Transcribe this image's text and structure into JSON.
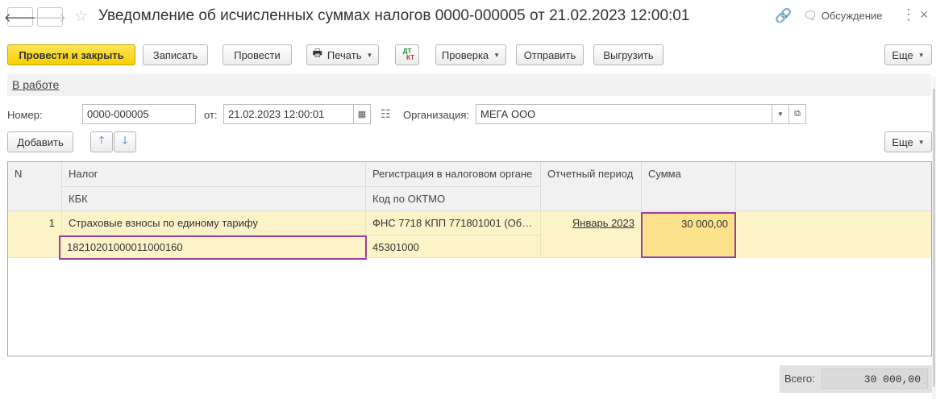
{
  "window": {
    "title": "Уведомление об исчисленных суммах налогов 0000-000005 от 21.02.2023 12:00:01",
    "discuss_label": "Обсуждение",
    "back_icon": "🡐",
    "forward_icon": "🡒",
    "star_icon": "☆",
    "link_icon": "🔗",
    "more_icon": "⋮",
    "close_icon": "×"
  },
  "toolbar": {
    "post_close": "Провести и закрыть",
    "save": "Записать",
    "post": "Провести",
    "print": "Печать",
    "dtkt_top": "ДТ",
    "dtkt_bottom": "КТ",
    "check": "Проверка",
    "send": "Отправить",
    "export": "Выгрузить",
    "more": "Еще"
  },
  "status": {
    "label": "В работе"
  },
  "fields": {
    "number_label": "Номер:",
    "number_value": "0000-000005",
    "date_label": "от:",
    "date_value": "21.02.2023 12:00:01",
    "org_label": "Организация:",
    "org_value": "МЕГА ООО"
  },
  "table_toolbar": {
    "add": "Добавить",
    "up_icon": "🡑",
    "down_icon": "🡓",
    "more": "Еще"
  },
  "table": {
    "headers": {
      "n": "N",
      "tax": "Налог",
      "kbk": "КБК",
      "reg": "Регистрация в налоговом органе",
      "oktmo": "Код по ОКТМО",
      "period": "Отчетный период",
      "sum": "Сумма"
    },
    "rows": [
      {
        "n": "1",
        "tax": "Страховые взносы по единому тарифу",
        "kbk": "18210201000011000160",
        "reg": "ФНС 7718 КПП 771801001 (Об…",
        "oktmo": "45301000",
        "period": "Январь 2023",
        "sum": "30 000,00"
      }
    ]
  },
  "footer": {
    "total_label": "Всего:",
    "total_value": "30 000,00"
  },
  "colors": {
    "primary_button": "#f6cf00",
    "selected_row": "#fdf3c9",
    "selected_cell_border": "#9b3f98",
    "sum_cell": "#fce28d"
  }
}
